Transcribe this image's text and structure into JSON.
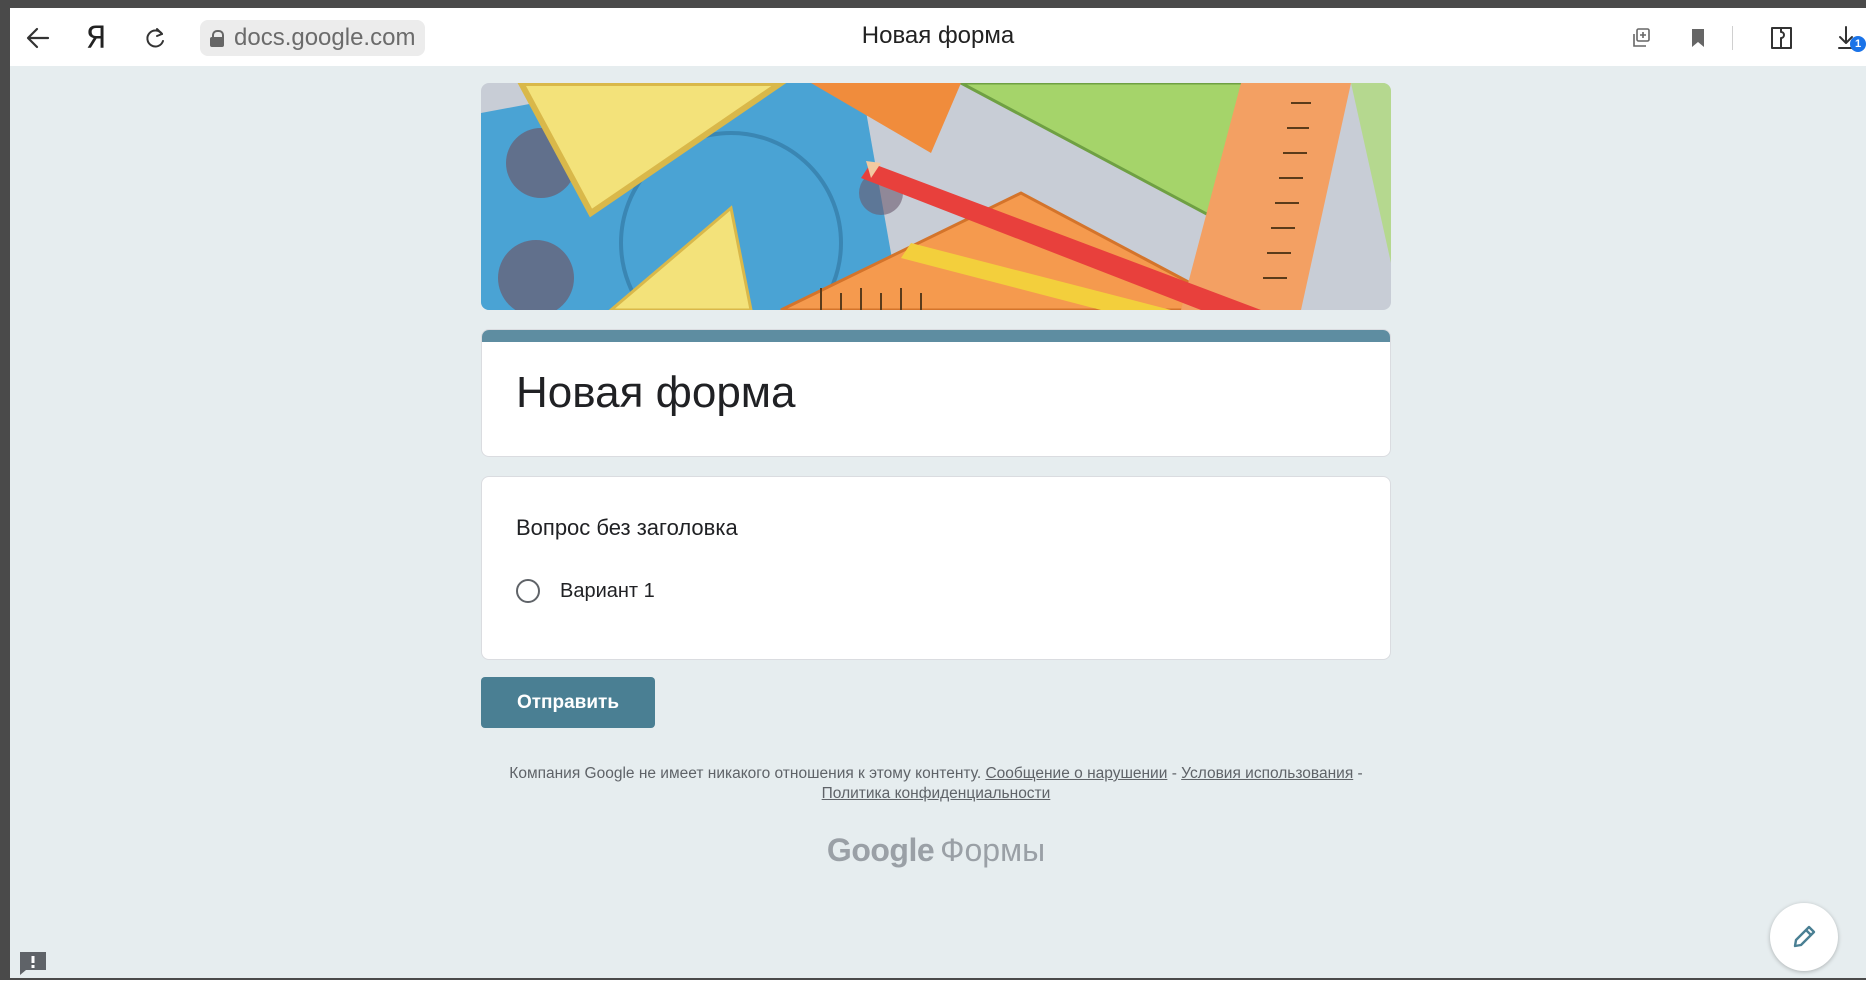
{
  "browser": {
    "url": "docs.google.com",
    "tab_title": "Новая форма",
    "yandex_glyph": "Я",
    "download_badge": "1",
    "icons": [
      "back-arrow-icon",
      "yandex-icon",
      "reload-icon",
      "lock-icon",
      "copy-icon",
      "bookmark-icon",
      "extensions-icon",
      "download-icon"
    ]
  },
  "form": {
    "title": "Новая форма",
    "accent_color": "#5e8da1",
    "question": {
      "title": "Вопрос без заголовка",
      "options": [
        "Вариант 1"
      ]
    },
    "submit_label": "Отправить",
    "submit_color": "#4a7f93"
  },
  "footer": {
    "disclaimer": "Компания Google не имеет никакого отношения к этому контенту.",
    "report_link": "Сообщение о нарушении",
    "sep1": "-",
    "terms_link": "Условия использования",
    "sep2": "-",
    "privacy_link": "Политика конфиденциальности"
  },
  "branding": {
    "google": "Google",
    "forms": "Формы"
  },
  "colors": {
    "page_background": "#e6edef"
  }
}
